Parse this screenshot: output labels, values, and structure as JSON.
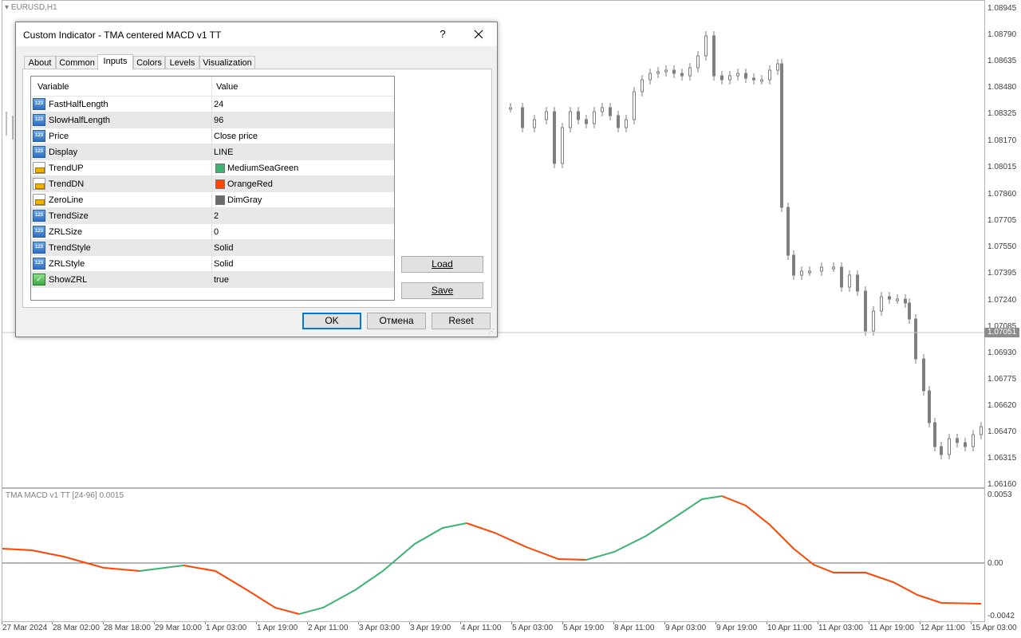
{
  "chart": {
    "symbol": "EURUSD,H1",
    "price_labels": [
      "1.08945",
      "1.08790",
      "1.08635",
      "1.08480",
      "1.08325",
      "1.08170",
      "1.08015",
      "1.07860",
      "1.07705",
      "1.07550",
      "1.07395",
      "1.07240",
      "1.07085",
      "1.06930",
      "1.06775",
      "1.06620",
      "1.06470",
      "1.06315",
      "1.06160"
    ],
    "current_price": "1.07051",
    "indicator_label": "TMA MACD v1 TT [24-96] 0.0015",
    "indicator_scale": [
      "0.0053",
      "0.00",
      "-0.0042"
    ],
    "time_labels": [
      "27 Mar 2024",
      "28 Mar 02:00",
      "28 Mar 18:00",
      "29 Mar 10:00",
      "1 Apr 03:00",
      "1 Apr 19:00",
      "2 Apr 11:00",
      "3 Apr 03:00",
      "3 Apr 19:00",
      "4 Apr 11:00",
      "5 Apr 03:00",
      "5 Apr 19:00",
      "8 Apr 11:00",
      "9 Apr 03:00",
      "9 Apr 19:00",
      "10 Apr 11:00",
      "11 Apr 03:00",
      "11 Apr 19:00",
      "12 Apr 11:00",
      "15 Apr 03:00"
    ],
    "colors": {
      "trend_up": "#3cb371",
      "trend_dn": "#ff4500",
      "zero": "#696969",
      "candle": "#7f7f7f"
    }
  },
  "dialog": {
    "title": "Custom Indicator - TMA centered MACD v1 TT",
    "help": "?",
    "tabs": [
      "About",
      "Common",
      "Inputs",
      "Colors",
      "Levels",
      "Visualization"
    ],
    "active_tab": "Inputs",
    "columns": {
      "variable": "Variable",
      "value": "Value"
    },
    "rows": [
      {
        "icon": "123",
        "variable": "FastHalfLength",
        "value": "24"
      },
      {
        "icon": "123",
        "variable": "SlowHalfLength",
        "value": "96"
      },
      {
        "icon": "123",
        "variable": "Price",
        "value": "Close price"
      },
      {
        "icon": "123",
        "variable": "Display",
        "value": "LINE"
      },
      {
        "icon": "color",
        "variable": "TrendUP",
        "value": "MediumSeaGreen",
        "color": "#3cb371"
      },
      {
        "icon": "color",
        "variable": "TrendDN",
        "value": "OrangeRed",
        "color": "#ff4500"
      },
      {
        "icon": "color",
        "variable": "ZeroLine",
        "value": "DimGray",
        "color": "#696969"
      },
      {
        "icon": "123",
        "variable": "TrendSize",
        "value": "2"
      },
      {
        "icon": "123",
        "variable": "ZRLSize",
        "value": "0"
      },
      {
        "icon": "123",
        "variable": "TrendStyle",
        "value": "Solid"
      },
      {
        "icon": "123",
        "variable": "ZRLStyle",
        "value": "Solid"
      },
      {
        "icon": "bool",
        "variable": "ShowZRL",
        "value": "true"
      }
    ],
    "buttons": {
      "load": "Load",
      "save": "Save",
      "ok": "OK",
      "cancel": "Отмена",
      "reset": "Reset"
    }
  }
}
